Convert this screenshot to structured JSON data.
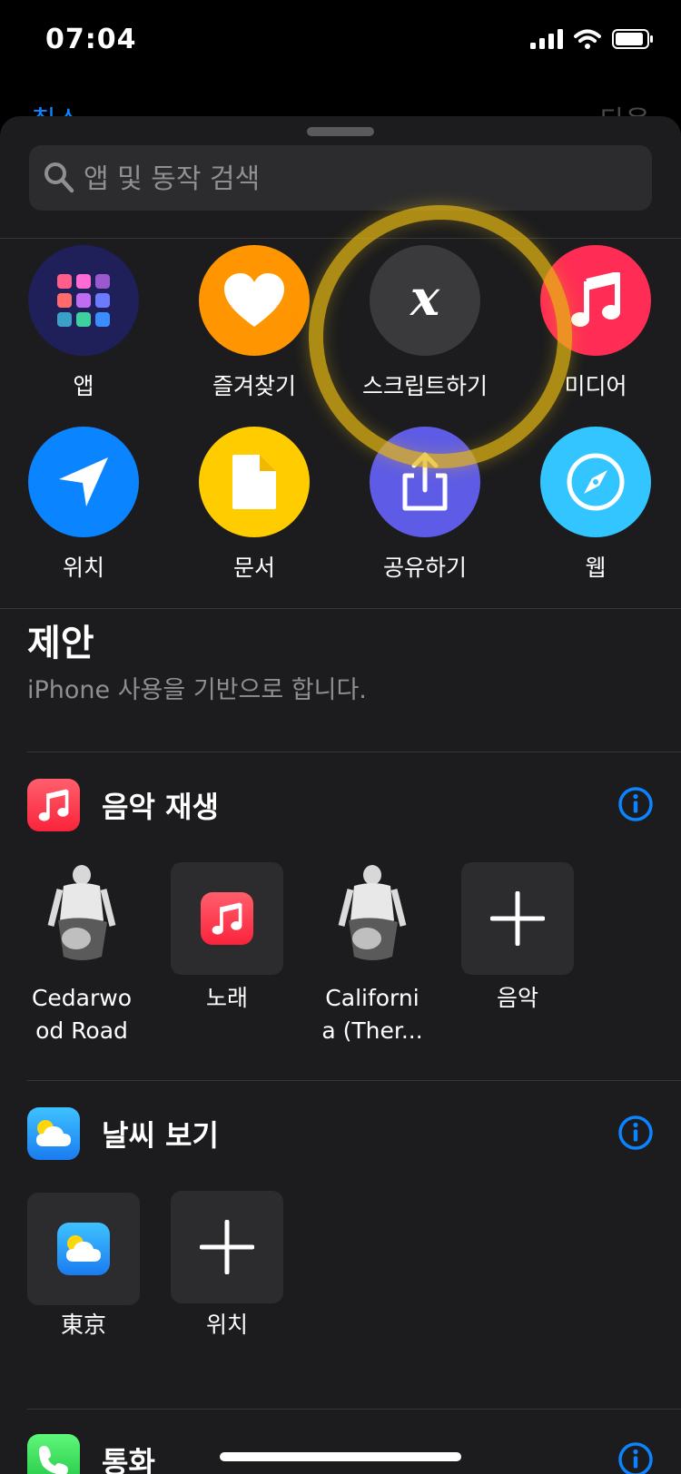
{
  "status_bar": {
    "time": "07:04"
  },
  "behind": {
    "left_label": "취소",
    "right_label": "다음"
  },
  "search": {
    "placeholder": "앱 및 동작 검색"
  },
  "categories": [
    {
      "label": "앱",
      "icon": "apps-grid-icon",
      "color": "#1f1f5a"
    },
    {
      "label": "즐겨찾기",
      "icon": "heart-icon",
      "color": "#ff9500"
    },
    {
      "label": "스크립트하기",
      "icon": "script-x-icon",
      "color": "#3a3a3c"
    },
    {
      "label": "미디어",
      "icon": "music-note-icon",
      "color": "#ff2d55"
    },
    {
      "label": "위치",
      "icon": "location-arrow-icon",
      "color": "#0a84ff"
    },
    {
      "label": "문서",
      "icon": "document-icon",
      "color": "#ffcc00"
    },
    {
      "label": "공유하기",
      "icon": "share-icon",
      "color": "#5e5ce6"
    },
    {
      "label": "웹",
      "icon": "safari-compass-icon",
      "color": "#32c5ff"
    }
  ],
  "suggestions": {
    "title": "제안",
    "subtitle": "iPhone 사용을 기반으로 합니다.",
    "sections": [
      {
        "title": "음악 재생",
        "icon": "music-app-icon",
        "items": [
          {
            "label_line1": "Cedarwo",
            "label_line2": "od Road",
            "icon": "album-art"
          },
          {
            "label_line1": "노래",
            "label_line2": "",
            "icon": "music-app-icon"
          },
          {
            "label_line1": "Californi",
            "label_line2": "a (Ther...",
            "icon": "album-art"
          },
          {
            "label_line1": "음악",
            "label_line2": "",
            "icon": "plus-icon"
          }
        ]
      },
      {
        "title": "날씨 보기",
        "icon": "weather-app-icon",
        "items": [
          {
            "label_line1": "東京",
            "label_line2": "",
            "icon": "weather-app-icon"
          },
          {
            "label_line1": "위치",
            "label_line2": "",
            "icon": "plus-icon"
          }
        ]
      },
      {
        "title": "통화",
        "icon": "phone-app-icon",
        "items": []
      }
    ]
  },
  "colors": {
    "accent": "#0a84ff",
    "highlight": "#e6b914",
    "sheet": "#1c1c1e"
  }
}
